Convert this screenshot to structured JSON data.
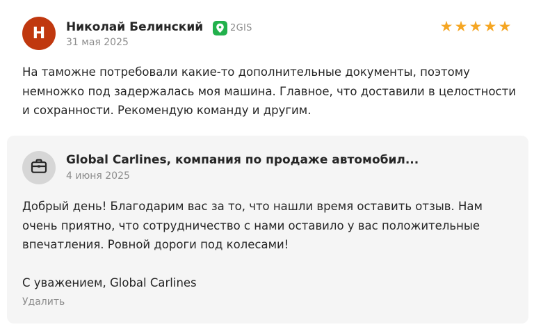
{
  "review": {
    "avatar_letter": "Н",
    "avatar_color": "#c0380f",
    "author": "Николай Белинский",
    "source": {
      "label": "2GIS",
      "icon": "2gis-icon",
      "color": "#22b14c"
    },
    "date": "31 мая 2025",
    "rating": 5,
    "rating_max": 5,
    "star_color": "#f5a623",
    "text": "На таможне потребовали какие-то дополнительные документы, поэтому немножко под задержалась моя машина. Главное, что доставили в целостности и сохранности. Рекомендую команду и другим."
  },
  "reply": {
    "icon": "briefcase-icon",
    "company": "Global Carlines, компания по продаже автомобил...",
    "date": "4 июня 2025",
    "text": "Добрый день! Благодарим вас за то, что нашли время оставить отзыв. Нам очень приятно, что сотрудничество с нами оставило у вас положительные впечатления. Ровной дороги под колесами!",
    "signature": "С уважением, Global Carlines",
    "delete_label": "Удалить"
  }
}
